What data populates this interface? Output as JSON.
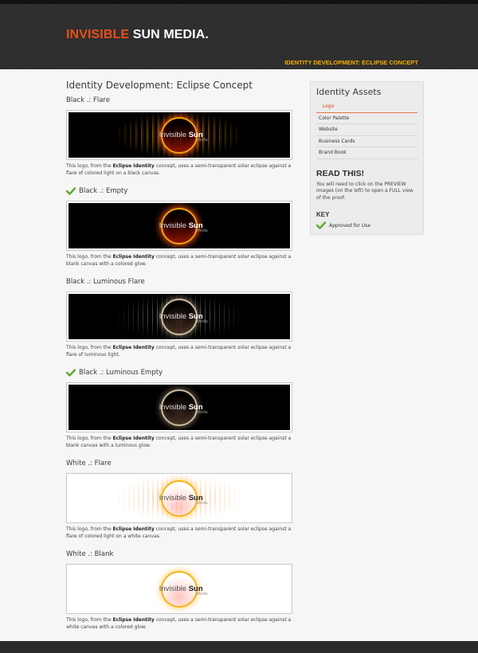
{
  "header": {
    "brand_part1": "INVISIBLE",
    "brand_part2": "SUN MEDIA.",
    "nav_active": "IDENTITY DEVELOPMENT: ECLIPSE CONCEPT"
  },
  "main": {
    "title": "Identity Development: Eclipse Concept",
    "sections": [
      {
        "title": "Black .: Flare",
        "approved": false,
        "style": "dark-flare",
        "caption_pre": "This logo, from the ",
        "caption_bold": "Eclipse Identity",
        "caption_post": " concept, uses a semi-transparent solar eclipse against a flare of colored light on a black canvas."
      },
      {
        "title": "Black .: Empty",
        "approved": true,
        "style": "dark-empty",
        "caption_pre": "This logo, from the ",
        "caption_bold": "Eclipse Identity",
        "caption_post": " concept, uses a semi-transparent solar eclipse against a blank canvas with a colored glow."
      },
      {
        "title": "Black .: Luminous Flare",
        "approved": false,
        "style": "dark-lum-flare",
        "caption_pre": "This logo, from the ",
        "caption_bold": "Eclipse Identity",
        "caption_post": " concept, uses a semi-transparent solar eclipse against a flare of luminous light."
      },
      {
        "title": "Black .: Luminous Empty",
        "approved": true,
        "style": "dark-lum-empty",
        "caption_pre": "This logo, from the ",
        "caption_bold": "Eclipse Identity",
        "caption_post": " concept, uses a semi-transparent solar eclipse against a blank canvas with a luminous glow."
      },
      {
        "title": "White .: Flare",
        "approved": false,
        "style": "light-flare",
        "caption_pre": "This logo, from the ",
        "caption_bold": "Eclipse Identity",
        "caption_post": " concept, uses a semi-transparent solar eclipse against a flare of colored light on a white canvas."
      },
      {
        "title": "White .: Blank",
        "approved": false,
        "style": "light-blank",
        "caption_pre": "This logo, from the ",
        "caption_bold": "Eclipse Identity",
        "caption_post": " concept, uses a semi-transparent solar eclipse against a white canvas with a colored glow."
      }
    ],
    "logo_word1": "Invisible",
    "logo_word2": "Sun",
    "logo_sub": "Media"
  },
  "sidebar": {
    "title": "Identity Assets",
    "items": [
      "Logo",
      "Color Palette",
      "Website",
      "Business Cards",
      "Brand Book"
    ],
    "active_index": 0,
    "read_title": "READ THIS!",
    "read_text": "You will need to click on the PREVIEW images (on the left) to open a FULL view of the proof.",
    "key_title": "KEY",
    "key_label": "Approved for Use"
  },
  "colors": {
    "accent": "#e8501a",
    "nav_active": "#f5b000",
    "header_bg": "#2d2d2d",
    "check": "#5ea82a"
  },
  "icons": {
    "approved": "check-icon"
  }
}
